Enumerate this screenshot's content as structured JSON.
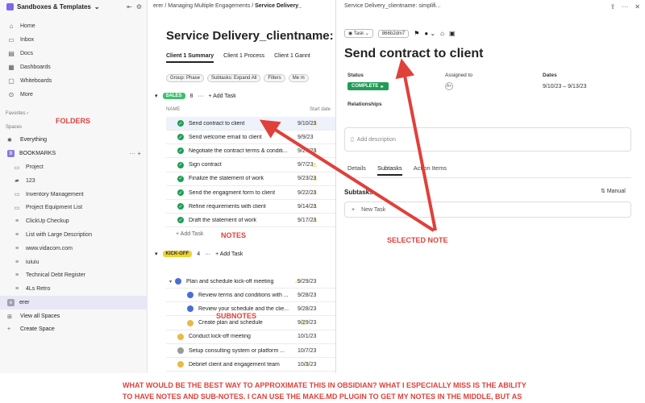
{
  "sidebar": {
    "workspace": "Sandboxes & Templates",
    "nav": [
      {
        "label": "Home",
        "icon": "home-icon"
      },
      {
        "label": "Inbox",
        "icon": "inbox-icon"
      },
      {
        "label": "Docs",
        "icon": "docs-icon"
      },
      {
        "label": "Dashboards",
        "icon": "dashboard-icon"
      },
      {
        "label": "Whiteboards",
        "icon": "whiteboard-icon"
      },
      {
        "label": "More",
        "icon": "more-icon"
      }
    ],
    "favorites_label": "Favorites",
    "spaces_label": "Spaces",
    "everything": "Everything",
    "bookmarks": "BOOKMARKS",
    "folders": [
      "Project",
      "123",
      "Inventory Management",
      "Project Equipment List",
      "ClickUp Checkup",
      "List with Large Description",
      "www.vidacom.com",
      "iuiuiu",
      "Technical Debt Register",
      "4Ls Retro"
    ],
    "active_space": "erer",
    "view_all": "View all Spaces",
    "create_space": "Create Space"
  },
  "main": {
    "breadcrumb": [
      "erer",
      "Managing Multiple Engagements",
      "Service Delivery_"
    ],
    "title": "Service Delivery_clientname: simp",
    "views": [
      "Client 1 Summary",
      "Client 1 Process",
      "Client 1 Gannt"
    ],
    "filters": [
      "Group: Phase",
      "Subtasks: Expand All",
      "Filters",
      "Me m"
    ],
    "group_sales": {
      "tag": "SALES",
      "count": "8",
      "add": "Add Task"
    },
    "col_name": "NAME",
    "col_date": "Start date",
    "sales_tasks": [
      {
        "name": "Send contract to client",
        "date": "9/10/23"
      },
      {
        "name": "Send welcome email to client",
        "date": "9/9/23"
      },
      {
        "name": "Negotiate the contract terms & conditi...",
        "date": "9/27/23"
      },
      {
        "name": "Sign contract",
        "date": "9/7/23"
      },
      {
        "name": "Finalize the statement of work",
        "date": "9/23/23"
      },
      {
        "name": "Send the engagment form to client",
        "date": "9/22/23"
      },
      {
        "name": "Refine requirements with client",
        "date": "9/14/23"
      },
      {
        "name": "Draft the statement of work",
        "date": "9/17/23"
      }
    ],
    "add_task": "Add Task",
    "group_kickoff": {
      "tag": "KICK-OFF",
      "count": "4",
      "add": "Add Task"
    },
    "kickoff_tasks": [
      {
        "name": "Plan and schedule kick-off meeting",
        "date": "9/29/23",
        "sub": "3"
      },
      {
        "name": "Review terms and conditions with ...",
        "date": "9/28/23"
      },
      {
        "name": "Review your schedule and the clie...",
        "date": "9/28/23"
      },
      {
        "name": "Create plan and schedule",
        "date": "9/29/23"
      },
      {
        "name": "Conduct kick-off meeting",
        "date": "10/1/23"
      },
      {
        "name": "Setup consulting system or platform ...",
        "date": "10/7/23"
      },
      {
        "name": "Debrief client and engagement team",
        "date": "10/3/23"
      }
    ]
  },
  "detail": {
    "header": "Service Delivery_clientname: simplifi...",
    "type_pill": "Task",
    "id_pill": "866b2dm7",
    "title": "Send contract to client",
    "status_label": "Status",
    "status_value": "COMPLETE",
    "assigned_label": "Assigned to",
    "dates_label": "Dates",
    "dates_value": "9/10/23 – 9/13/23",
    "relationships_label": "Relationships",
    "description_placeholder": "Add description",
    "tabs": [
      "Details",
      "Subtasks",
      "Action Items"
    ],
    "subtasks_label": "Subtasks",
    "sort_label": "Manual",
    "new_task": "New Task"
  },
  "annotations": {
    "folders": "FOLDERS",
    "notes": "NOTES",
    "subnotes": "SUBNOTES",
    "selected_note": "SELECTED NOTE",
    "question_line1": "WHAT WOULD BE THE BEST WAY TO APPROXIMATE THIS IN OBSIDIAN? WHAT I ESPECIALLY MISS IS THE ABILITY",
    "question_line2": "TO HAVE NOTES AND SUB-NOTES. I CAN USE THE MAKE.MD PLUGIN TO GET MY NOTES IN THE MIDDLE, BUT AS",
    "annotation_color": "#e0403a"
  },
  "colors": {
    "complete_green": "#1f9d55",
    "sales_tag": "#3fbf6f",
    "kickoff_tag": "#f2d32e",
    "progress_blue": "#4a6cd6",
    "todo_yellow": "#e9b949"
  }
}
